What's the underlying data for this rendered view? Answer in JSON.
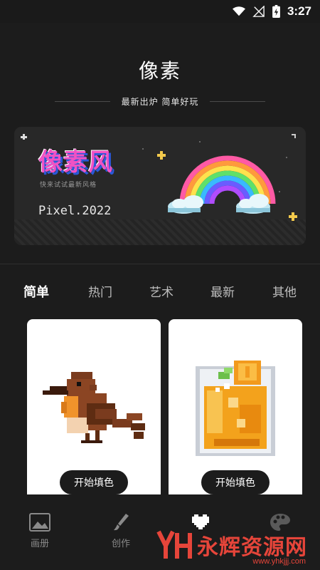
{
  "status_bar": {
    "time": "3:27"
  },
  "header": {
    "title": "像素",
    "subtitle": "最新出炉 简单好玩"
  },
  "banner": {
    "logo_text": "像素风",
    "tagline": "快来试试最新风格",
    "year_text": "Pixel.2022"
  },
  "tabs": [
    {
      "label": "简单",
      "active": true
    },
    {
      "label": "热门",
      "active": false
    },
    {
      "label": "艺术",
      "active": false
    },
    {
      "label": "最新",
      "active": false
    },
    {
      "label": "其他",
      "active": false
    }
  ],
  "cards": [
    {
      "image": "pixel-bird",
      "button_label": "开始填色"
    },
    {
      "image": "pixel-orange-drink",
      "button_label": "开始填色"
    }
  ],
  "bottom_nav": [
    {
      "label": "画册",
      "icon": "image-icon"
    },
    {
      "label": "创作",
      "icon": "brush-icon"
    },
    {
      "label": "",
      "icon": "heart-icon"
    },
    {
      "label": "",
      "icon": "palette-icon"
    }
  ],
  "watermark": {
    "text": "永辉资源网",
    "url": "www.yhkjjj.com"
  },
  "colors": {
    "background": "#1c1c1c",
    "banner": "#282828",
    "accent_pink": "#f052c4",
    "watermark_red": "#e6453a"
  }
}
